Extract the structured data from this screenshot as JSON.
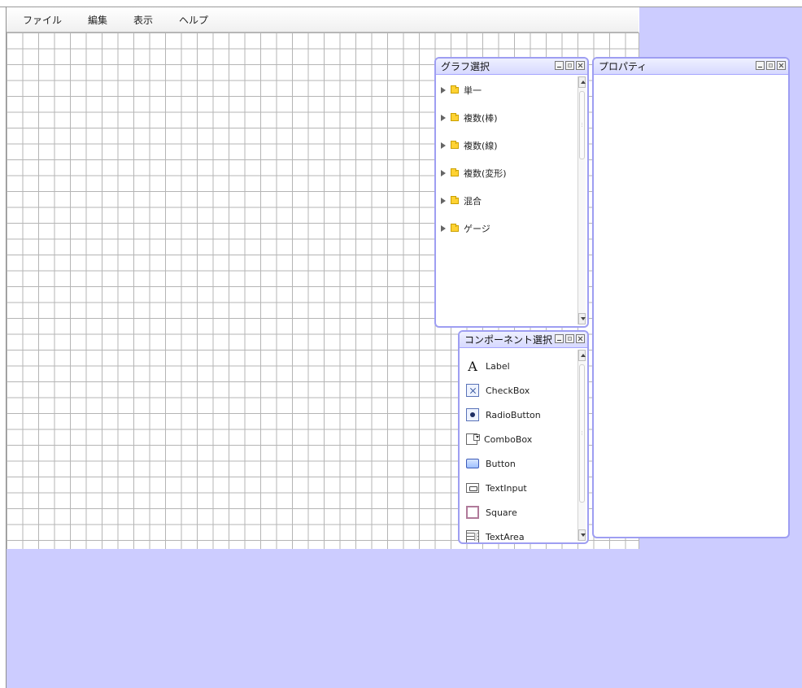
{
  "menubar": {
    "items": [
      "ファイル",
      "編集",
      "表示",
      "ヘルプ"
    ]
  },
  "panels": {
    "graph_select": {
      "title": "グラフ選択",
      "items": [
        "単一",
        "複数(棒)",
        "複数(線)",
        "複数(変形)",
        "混合",
        "ゲージ"
      ]
    },
    "properties": {
      "title": "プロパティ"
    },
    "component_select": {
      "title": "コンポーネント選択",
      "items": [
        {
          "label": "Label",
          "icon": "label-icon"
        },
        {
          "label": "CheckBox",
          "icon": "checkbox-icon"
        },
        {
          "label": "RadioButton",
          "icon": "radiobutton-icon"
        },
        {
          "label": "ComboBox",
          "icon": "combobox-icon"
        },
        {
          "label": "Button",
          "icon": "button-icon"
        },
        {
          "label": "TextInput",
          "icon": "textinput-icon"
        },
        {
          "label": "Square",
          "icon": "square-icon"
        },
        {
          "label": "TextArea",
          "icon": "textarea-icon"
        }
      ]
    }
  },
  "colors": {
    "background_lavender": "#ccccff",
    "panel_border": "#9e9ef2",
    "grid_line": "#b5b5b5"
  },
  "icons": {
    "label_glyph": "A"
  }
}
